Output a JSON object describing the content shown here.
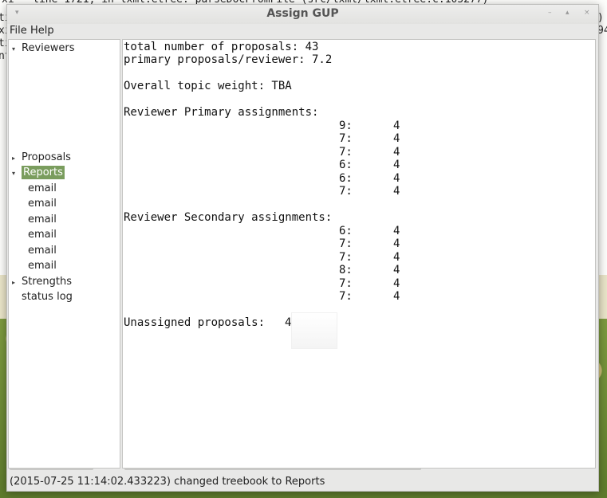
{
  "background_terminal": {
    "lines": [
      "xi\"  line 1721, in lxml.etree._parseDocFromFile (src/lxml/lxml.etree.c:105277)",
      "ti",
      "xi",
      "ti",
      "nt"
    ],
    "right_fragments": [
      ")",
      "94"
    ]
  },
  "window": {
    "title": "Assign GUP",
    "controls": [
      "–",
      "▴",
      "×"
    ]
  },
  "menubar": {
    "items": [
      "File",
      "Help"
    ]
  },
  "tree": {
    "items": [
      {
        "label": "Reviewers",
        "arrow": "▾",
        "indent": 0
      },
      {
        "label": "Proposals",
        "arrow": "▸",
        "indent": 0
      },
      {
        "label": "Reports",
        "arrow": "▾",
        "indent": 0,
        "selected": true
      },
      {
        "label": "email",
        "arrow": "",
        "indent": 1
      },
      {
        "label": "email",
        "arrow": "",
        "indent": 1
      },
      {
        "label": "email",
        "arrow": "",
        "indent": 1
      },
      {
        "label": "email",
        "arrow": "",
        "indent": 1
      },
      {
        "label": "email",
        "arrow": "",
        "indent": 1
      },
      {
        "label": "email",
        "arrow": "",
        "indent": 1
      },
      {
        "label": "Strengths",
        "arrow": "▸",
        "indent": 0
      },
      {
        "label": "status log",
        "arrow": "",
        "indent": 0
      }
    ],
    "selected_color": "#7a9d5e"
  },
  "report": {
    "total_line": "total number of proposals: 43",
    "primary_per_reviewer_line": "primary proposals/reviewer: 7.2",
    "topic_weight_line": "Overall topic weight: TBA",
    "primary_header": "Reviewer Primary assignments:",
    "primary_rows": [
      {
        "a": "9:",
        "b": "4"
      },
      {
        "a": "7:",
        "b": "4"
      },
      {
        "a": "7:",
        "b": "4"
      },
      {
        "a": "6:",
        "b": "4"
      },
      {
        "a": "6:",
        "b": "4"
      },
      {
        "a": "7:",
        "b": "4"
      }
    ],
    "secondary_header": "Reviewer Secondary assignments:",
    "secondary_rows": [
      {
        "a": "6:",
        "b": "4"
      },
      {
        "a": "7:",
        "b": "4"
      },
      {
        "a": "7:",
        "b": "4"
      },
      {
        "a": "8:",
        "b": "4"
      },
      {
        "a": "7:",
        "b": "4"
      },
      {
        "a": "7:",
        "b": "4"
      }
    ],
    "unassigned_line": "Unassigned proposals:",
    "unassigned_value": "4"
  },
  "statusbar": {
    "text": "(2015-07-25 11:14:02.433223) changed treebook to Reports"
  }
}
